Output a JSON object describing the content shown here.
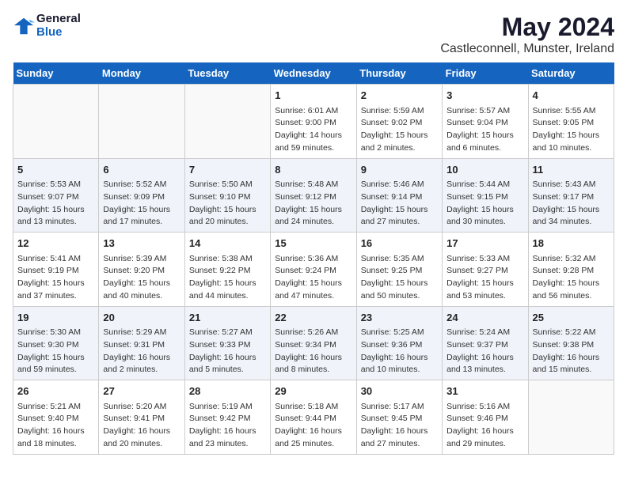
{
  "logo": {
    "text_general": "General",
    "text_blue": "Blue"
  },
  "title": "May 2024",
  "subtitle": "Castleconnell, Munster, Ireland",
  "days_of_week": [
    "Sunday",
    "Monday",
    "Tuesday",
    "Wednesday",
    "Thursday",
    "Friday",
    "Saturday"
  ],
  "weeks": [
    [
      {
        "day": "",
        "info": ""
      },
      {
        "day": "",
        "info": ""
      },
      {
        "day": "",
        "info": ""
      },
      {
        "day": "1",
        "info": "Sunrise: 6:01 AM\nSunset: 9:00 PM\nDaylight: 14 hours\nand 59 minutes."
      },
      {
        "day": "2",
        "info": "Sunrise: 5:59 AM\nSunset: 9:02 PM\nDaylight: 15 hours\nand 2 minutes."
      },
      {
        "day": "3",
        "info": "Sunrise: 5:57 AM\nSunset: 9:04 PM\nDaylight: 15 hours\nand 6 minutes."
      },
      {
        "day": "4",
        "info": "Sunrise: 5:55 AM\nSunset: 9:05 PM\nDaylight: 15 hours\nand 10 minutes."
      }
    ],
    [
      {
        "day": "5",
        "info": "Sunrise: 5:53 AM\nSunset: 9:07 PM\nDaylight: 15 hours\nand 13 minutes."
      },
      {
        "day": "6",
        "info": "Sunrise: 5:52 AM\nSunset: 9:09 PM\nDaylight: 15 hours\nand 17 minutes."
      },
      {
        "day": "7",
        "info": "Sunrise: 5:50 AM\nSunset: 9:10 PM\nDaylight: 15 hours\nand 20 minutes."
      },
      {
        "day": "8",
        "info": "Sunrise: 5:48 AM\nSunset: 9:12 PM\nDaylight: 15 hours\nand 24 minutes."
      },
      {
        "day": "9",
        "info": "Sunrise: 5:46 AM\nSunset: 9:14 PM\nDaylight: 15 hours\nand 27 minutes."
      },
      {
        "day": "10",
        "info": "Sunrise: 5:44 AM\nSunset: 9:15 PM\nDaylight: 15 hours\nand 30 minutes."
      },
      {
        "day": "11",
        "info": "Sunrise: 5:43 AM\nSunset: 9:17 PM\nDaylight: 15 hours\nand 34 minutes."
      }
    ],
    [
      {
        "day": "12",
        "info": "Sunrise: 5:41 AM\nSunset: 9:19 PM\nDaylight: 15 hours\nand 37 minutes."
      },
      {
        "day": "13",
        "info": "Sunrise: 5:39 AM\nSunset: 9:20 PM\nDaylight: 15 hours\nand 40 minutes."
      },
      {
        "day": "14",
        "info": "Sunrise: 5:38 AM\nSunset: 9:22 PM\nDaylight: 15 hours\nand 44 minutes."
      },
      {
        "day": "15",
        "info": "Sunrise: 5:36 AM\nSunset: 9:24 PM\nDaylight: 15 hours\nand 47 minutes."
      },
      {
        "day": "16",
        "info": "Sunrise: 5:35 AM\nSunset: 9:25 PM\nDaylight: 15 hours\nand 50 minutes."
      },
      {
        "day": "17",
        "info": "Sunrise: 5:33 AM\nSunset: 9:27 PM\nDaylight: 15 hours\nand 53 minutes."
      },
      {
        "day": "18",
        "info": "Sunrise: 5:32 AM\nSunset: 9:28 PM\nDaylight: 15 hours\nand 56 minutes."
      }
    ],
    [
      {
        "day": "19",
        "info": "Sunrise: 5:30 AM\nSunset: 9:30 PM\nDaylight: 15 hours\nand 59 minutes."
      },
      {
        "day": "20",
        "info": "Sunrise: 5:29 AM\nSunset: 9:31 PM\nDaylight: 16 hours\nand 2 minutes."
      },
      {
        "day": "21",
        "info": "Sunrise: 5:27 AM\nSunset: 9:33 PM\nDaylight: 16 hours\nand 5 minutes."
      },
      {
        "day": "22",
        "info": "Sunrise: 5:26 AM\nSunset: 9:34 PM\nDaylight: 16 hours\nand 8 minutes."
      },
      {
        "day": "23",
        "info": "Sunrise: 5:25 AM\nSunset: 9:36 PM\nDaylight: 16 hours\nand 10 minutes."
      },
      {
        "day": "24",
        "info": "Sunrise: 5:24 AM\nSunset: 9:37 PM\nDaylight: 16 hours\nand 13 minutes."
      },
      {
        "day": "25",
        "info": "Sunrise: 5:22 AM\nSunset: 9:38 PM\nDaylight: 16 hours\nand 15 minutes."
      }
    ],
    [
      {
        "day": "26",
        "info": "Sunrise: 5:21 AM\nSunset: 9:40 PM\nDaylight: 16 hours\nand 18 minutes."
      },
      {
        "day": "27",
        "info": "Sunrise: 5:20 AM\nSunset: 9:41 PM\nDaylight: 16 hours\nand 20 minutes."
      },
      {
        "day": "28",
        "info": "Sunrise: 5:19 AM\nSunset: 9:42 PM\nDaylight: 16 hours\nand 23 minutes."
      },
      {
        "day": "29",
        "info": "Sunrise: 5:18 AM\nSunset: 9:44 PM\nDaylight: 16 hours\nand 25 minutes."
      },
      {
        "day": "30",
        "info": "Sunrise: 5:17 AM\nSunset: 9:45 PM\nDaylight: 16 hours\nand 27 minutes."
      },
      {
        "day": "31",
        "info": "Sunrise: 5:16 AM\nSunset: 9:46 PM\nDaylight: 16 hours\nand 29 minutes."
      },
      {
        "day": "",
        "info": ""
      }
    ]
  ]
}
